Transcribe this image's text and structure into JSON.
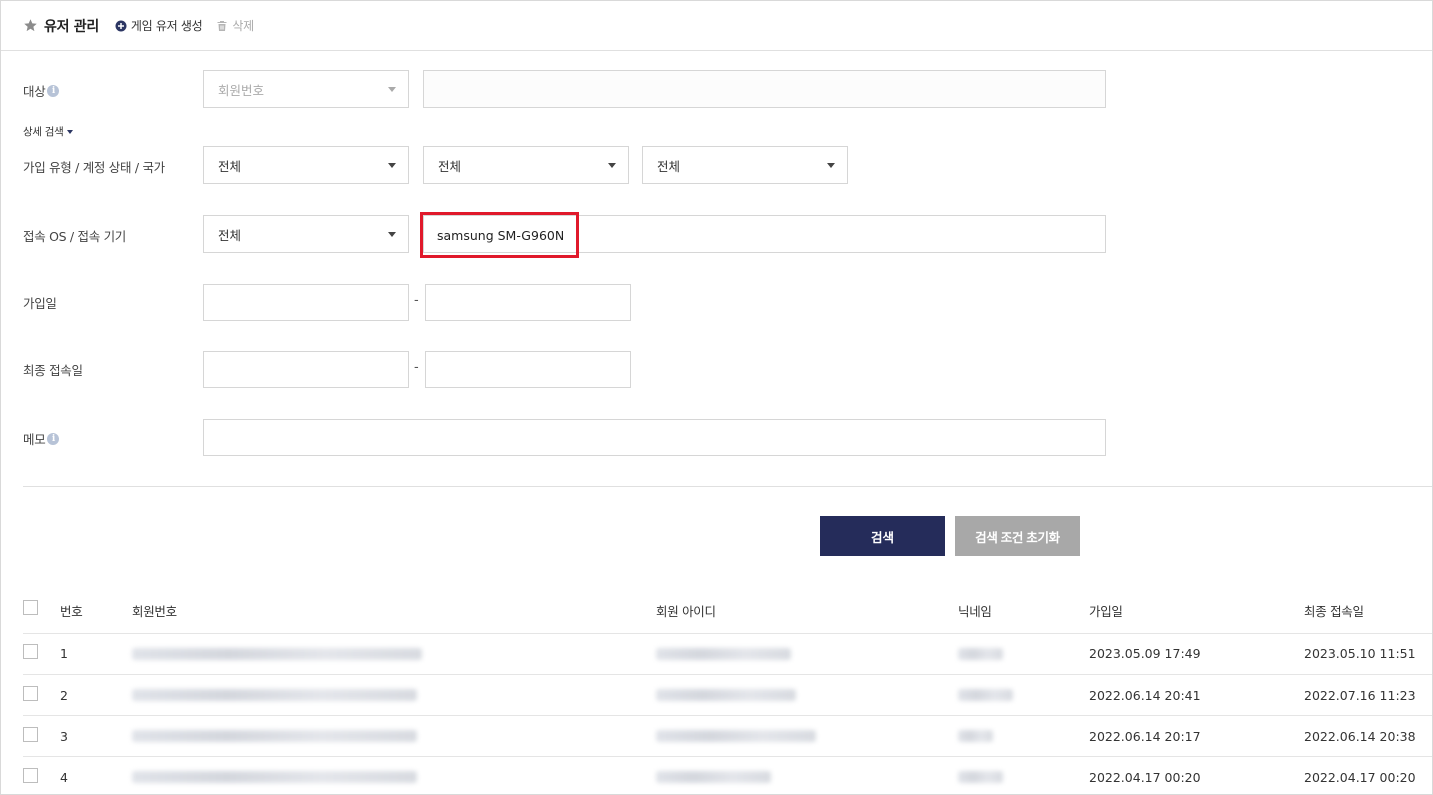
{
  "header": {
    "title": "유저 관리",
    "create_label": "게임 유저 생성",
    "delete_label": "삭제"
  },
  "form": {
    "target": {
      "label": "대상",
      "select_value": "회원번호",
      "input_value": ""
    },
    "detail_toggle": "상세 검색",
    "signup_row": {
      "label": "가입 유형 / 계정 상태 / 국가",
      "signup_type": "전체",
      "account_status": "전체",
      "country": "전체"
    },
    "os_row": {
      "label": "접속 OS / 접속 기기",
      "os": "전체",
      "device_value": "samsung SM-G960N"
    },
    "signup_date": {
      "label": "가입일",
      "from": "",
      "to": "",
      "separator": "-"
    },
    "last_login": {
      "label": "최종 접속일",
      "from": "",
      "to": "",
      "separator": "-"
    },
    "memo": {
      "label": "메모",
      "value": ""
    }
  },
  "buttons": {
    "search": "검색",
    "reset": "검색 조건 초기화"
  },
  "table": {
    "columns": [
      "번호",
      "회원번호",
      "회원 아이디",
      "닉네임",
      "가입일",
      "최종 접속일"
    ],
    "rows": [
      {
        "no": "1",
        "joined": "2023.05.09 17:49",
        "last": "2023.05.10 11:51"
      },
      {
        "no": "2",
        "joined": "2022.06.14 20:41",
        "last": "2022.07.16 11:23"
      },
      {
        "no": "3",
        "joined": "2022.06.14 20:17",
        "last": "2022.06.14 20:38"
      },
      {
        "no": "4",
        "joined": "2022.04.17 00:20",
        "last": "2022.04.17 00:20"
      }
    ]
  },
  "icons": {
    "title": "star-icon",
    "create": "plus-circle-icon",
    "delete": "trash-icon",
    "info": "info-icon"
  },
  "colors": {
    "primary": "#252c5a",
    "secondary_button": "#a8a8a8",
    "highlight": "#e0192b"
  }
}
